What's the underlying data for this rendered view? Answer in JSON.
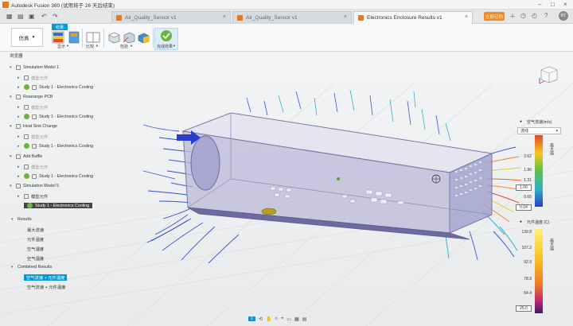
{
  "window": {
    "title": "Autodesk Fusion 360 (试用将于 26 天后结束)"
  },
  "tabs": [
    {
      "label": "Air_Quality_Sensor v1"
    },
    {
      "label": "Air_Quality_Sensor v1"
    },
    {
      "label": "Electronics Enclosure Results v1"
    }
  ],
  "header": {
    "trial_button": "立即订购",
    "user_initials": "BT"
  },
  "ribbon": {
    "workspace_label": "仿真",
    "active_tab": "结果",
    "tools": [
      {
        "label": "显示"
      },
      {
        "label": "比较"
      },
      {
        "label": "检验"
      },
      {
        "label": "完成结果"
      }
    ]
  },
  "browser": {
    "header": "浏览器",
    "items": [
      {
        "label": "Simulation Model 1"
      },
      {
        "label": "模型元件"
      },
      {
        "label": "Study 1 - Electronics Cooling"
      },
      {
        "label": "Rearrange PCB"
      },
      {
        "label": "模型元件"
      },
      {
        "label": "Study 1 - Electronics Cooling"
      },
      {
        "label": "Heat Sink Change"
      },
      {
        "label": "模型元件"
      },
      {
        "label": "Study 1 - Electronics Cooling"
      },
      {
        "label": "Add Baffle"
      },
      {
        "label": "模型元件"
      },
      {
        "label": "Study 1 - Electronics Cooling"
      },
      {
        "label": "Simulation Model 5"
      },
      {
        "label": "模型元件"
      },
      {
        "label": "Study 1 - Electronics Cooling"
      }
    ],
    "results_header": "Results",
    "results": [
      {
        "label": "最大流速"
      },
      {
        "label": "元件温度"
      },
      {
        "label": "空气温度"
      },
      {
        "label": "空气温度"
      }
    ],
    "combined_header": "Combined Results",
    "combined": [
      {
        "label": "空气流速 + 元件温度"
      },
      {
        "label": "空气流速 + 元件温度"
      }
    ]
  },
  "legend_flow": {
    "title": "空气流速(m/s)",
    "mode": "流线",
    "values": [
      "2.62",
      "1.96",
      "1.31",
      "1.06",
      "0.65",
      "0.04"
    ],
    "unit_label": "最大值"
  },
  "legend_temp": {
    "title": "元件温度 (C)",
    "values": [
      "139.8",
      "107.2",
      "92.9",
      "78.9",
      "64.4",
      "25.0"
    ],
    "unit_label": "最大值"
  },
  "bottom": {
    "page": "1"
  },
  "colors": {
    "accent": "#0696d7",
    "brand": "#e87722",
    "trial": "#f08a24",
    "check": "#6db33f"
  }
}
